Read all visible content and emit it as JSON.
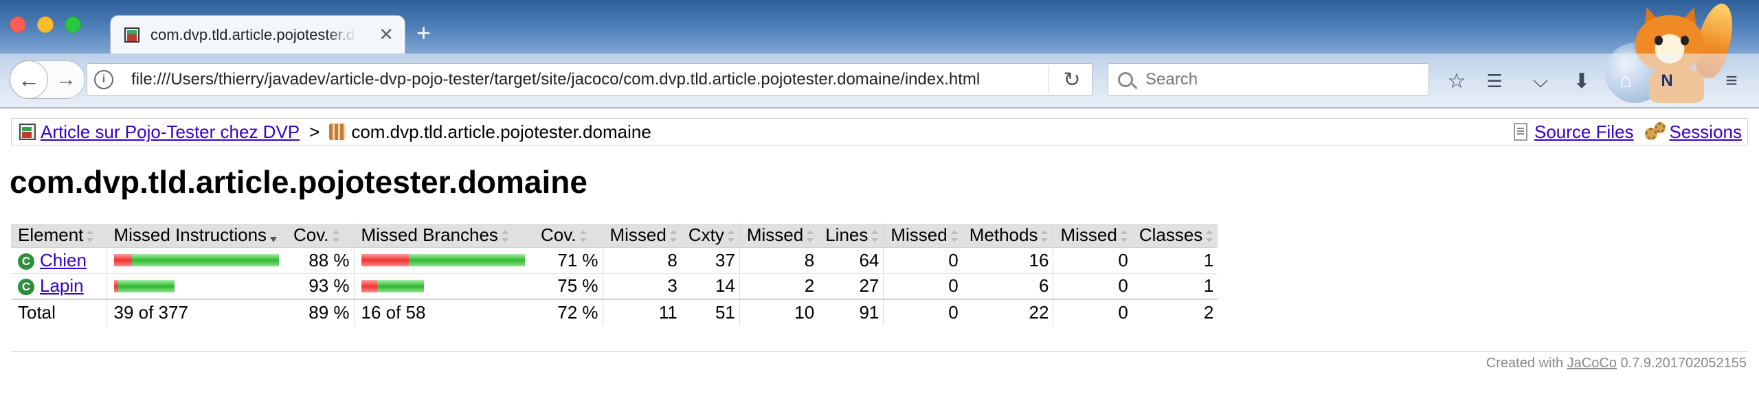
{
  "browser": {
    "tab_title": "com.dvp.tld.article.pojotester.domaine",
    "url": "file:///Users/thierry/javadev/article-dvp-pojo-tester/target/site/jacoco/com.dvp.tld.article.pojotester.domaine/index.html",
    "search_placeholder": "Search",
    "icons": [
      "back-icon",
      "forward-icon",
      "info-icon",
      "reload-icon",
      "search-icon",
      "bookmark-star-icon",
      "reading-list-icon",
      "pocket-icon",
      "download-icon",
      "home-icon",
      "notes-icon",
      "menu-icon"
    ]
  },
  "breadcrumb": {
    "root_link": "Article sur Pojo-Tester chez DVP",
    "separator": ">",
    "current": "com.dvp.tld.article.pojotester.domaine",
    "source_files": "Source Files",
    "sessions": "Sessions"
  },
  "page": {
    "title": "com.dvp.tld.article.pojotester.domaine"
  },
  "table": {
    "headers": {
      "element": "Element",
      "missed_instructions": "Missed Instructions",
      "cov1": "Cov.",
      "missed_branches": "Missed Branches",
      "cov2": "Cov.",
      "missed_cxty": "Missed",
      "cxty": "Cxty",
      "missed_lines": "Missed",
      "lines": "Lines",
      "missed_methods": "Missed",
      "methods": "Methods",
      "missed_classes": "Missed",
      "classes": "Classes"
    },
    "rows": [
      {
        "icon": "C",
        "name": "Chien",
        "instr_missed_frac": 0.11,
        "instr_covered_frac": 0.89,
        "instr_cov": "88 %",
        "branch_missed_frac": 0.29,
        "branch_covered_frac": 0.71,
        "branch_cov": "71 %",
        "missed_cxty": "8",
        "cxty": "37",
        "missed_lines": "8",
        "lines": "64",
        "missed_methods": "0",
        "methods": "16",
        "missed_classes": "0",
        "classes": "1"
      },
      {
        "icon": "C",
        "name": "Lapin",
        "instr_missed_frac": 0.07,
        "instr_covered_frac": 0.93,
        "instr_cov": "93 %",
        "branch_missed_frac": 0.25,
        "branch_covered_frac": 0.75,
        "branch_cov": "75 %",
        "missed_cxty": "3",
        "cxty": "14",
        "missed_lines": "2",
        "lines": "27",
        "missed_methods": "0",
        "methods": "6",
        "missed_classes": "0",
        "classes": "1"
      }
    ],
    "total": {
      "label": "Total",
      "instructions": "39 of 377",
      "instr_cov": "89 %",
      "branches": "16 of 58",
      "branch_cov": "72 %",
      "missed_cxty": "11",
      "cxty": "51",
      "missed_lines": "10",
      "lines": "91",
      "missed_methods": "0",
      "methods": "22",
      "missed_classes": "0",
      "classes": "2"
    }
  },
  "footer": {
    "prefix": "Created with",
    "link": "JaCoCo",
    "version": "0.7.9.201702052155"
  }
}
